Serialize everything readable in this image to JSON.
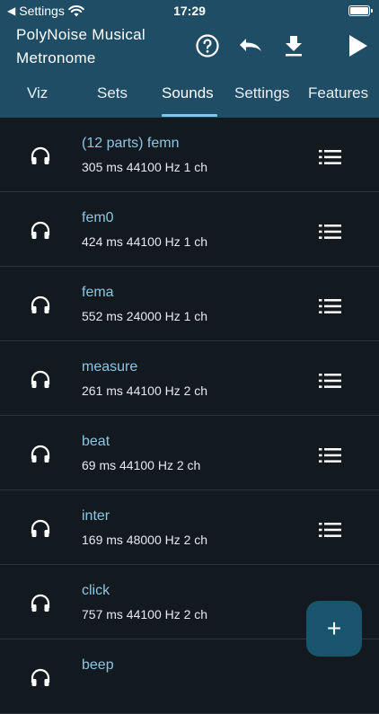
{
  "status_bar": {
    "back_label": "Settings",
    "time": "17:29"
  },
  "app": {
    "title": "PolyNoise Musical Metronome"
  },
  "toolbar": {
    "help_icon": "help-circle-icon",
    "undo_icon": "undo-icon",
    "download_icon": "download-icon",
    "play_icon": "play-icon"
  },
  "tabs": [
    {
      "label": "Viz",
      "selected": false
    },
    {
      "label": "Sets",
      "selected": false
    },
    {
      "label": "Sounds",
      "selected": true
    },
    {
      "label": "Settings",
      "selected": false
    },
    {
      "label": "Features",
      "selected": false
    }
  ],
  "sounds": [
    {
      "name": "(12 parts) femn",
      "meta": "305 ms 44100 Hz 1 ch"
    },
    {
      "name": "fem0",
      "meta": "424 ms 44100 Hz 1 ch"
    },
    {
      "name": "fema",
      "meta": "552 ms 24000 Hz 1 ch"
    },
    {
      "name": "measure",
      "meta": "261 ms 44100 Hz 2 ch"
    },
    {
      "name": "beat",
      "meta": "69 ms 44100 Hz 2 ch"
    },
    {
      "name": "inter",
      "meta": "169 ms 48000 Hz 2 ch"
    },
    {
      "name": "click",
      "meta": "757 ms 44100 Hz 2 ch"
    },
    {
      "name": "beep",
      "meta": ""
    }
  ],
  "fab": {
    "label": "+"
  },
  "colors": {
    "header": "#1f4d66",
    "background": "#121a1f",
    "accent": "#8cc6e4",
    "fab": "#19546f"
  }
}
